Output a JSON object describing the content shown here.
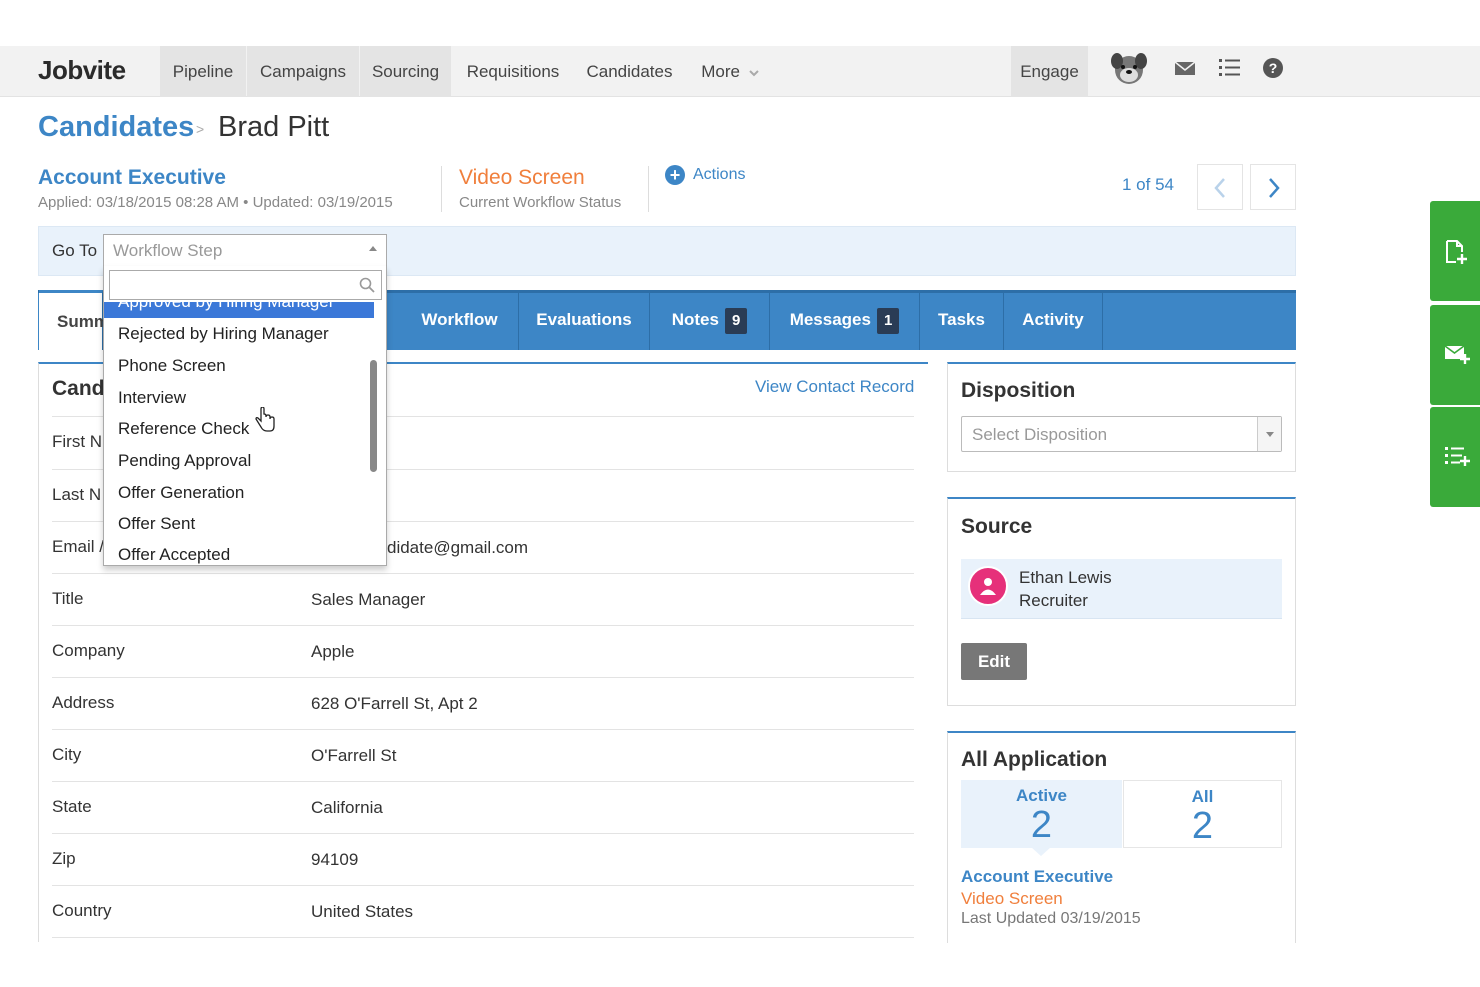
{
  "nav": {
    "logo": "Jobvite",
    "items": [
      "Pipeline",
      "Campaigns",
      "Sourcing",
      "Requisitions",
      "Candidates",
      "More"
    ],
    "engage": "Engage",
    "icons": [
      "avatar-dog-icon",
      "mail-icon",
      "list-icon",
      "help-icon"
    ]
  },
  "breadcrumb": {
    "parent": "Candidates",
    "sep": ">",
    "current": "Brad Pitt"
  },
  "job": {
    "title": "Account Executive",
    "meta": "Applied: 03/18/2015 08:28 AM  •  Updated: 03/19/2015",
    "workflow_status": "Video Screen",
    "workflow_label": "Current Workflow Status",
    "actions": "Actions"
  },
  "pager": {
    "text": "1  of  54"
  },
  "goto": {
    "label": "Go To",
    "placeholder": "Workflow Step"
  },
  "dropdown": {
    "items": [
      "Approved by Hiring Manager",
      "Rejected by Hiring Manager",
      "Phone Screen",
      "Interview",
      "Reference Check",
      "Pending Approval",
      "Offer Generation",
      "Offer Sent",
      "Offer Accepted"
    ]
  },
  "tabs": {
    "summary": "Summ",
    "workflow": "Workflow",
    "evaluations": "Evaluations",
    "notes": "Notes",
    "notes_count": "9",
    "messages": "Messages",
    "messages_count": "1",
    "tasks": "Tasks",
    "activity": "Activity"
  },
  "candidate": {
    "heading": "Cand",
    "view_contact": "View Contact Record",
    "fields": [
      {
        "label": "First N",
        "value": ""
      },
      {
        "label": "Last N",
        "value": ""
      },
      {
        "label": "Email /",
        "value": "didate@gmail.com"
      },
      {
        "label": "Title",
        "value": "Sales Manager"
      },
      {
        "label": "Company",
        "value": "Apple"
      },
      {
        "label": "Address",
        "value": "628 O'Farrell St, Apt 2"
      },
      {
        "label": "City",
        "value": "O'Farrell St"
      },
      {
        "label": "State",
        "value": "California"
      },
      {
        "label": "Zip",
        "value": "94109"
      },
      {
        "label": "Country",
        "value": "United States"
      }
    ]
  },
  "disposition": {
    "title": "Disposition",
    "placeholder": "Select Disposition"
  },
  "source": {
    "title": "Source",
    "name": "Ethan Lewis",
    "role": "Recruiter",
    "edit": "Edit"
  },
  "applications": {
    "title": "All Application",
    "active_label": "Active",
    "active_count": "2",
    "all_label": "All",
    "all_count": "2",
    "job": "Account Executive",
    "status": "Video Screen",
    "updated": "Last Updated  03/19/2015"
  },
  "colors": {
    "accent": "#3d86c6",
    "orange": "#f07f3c",
    "green": "#3aaa3a",
    "highlight": "#3b78d8"
  }
}
